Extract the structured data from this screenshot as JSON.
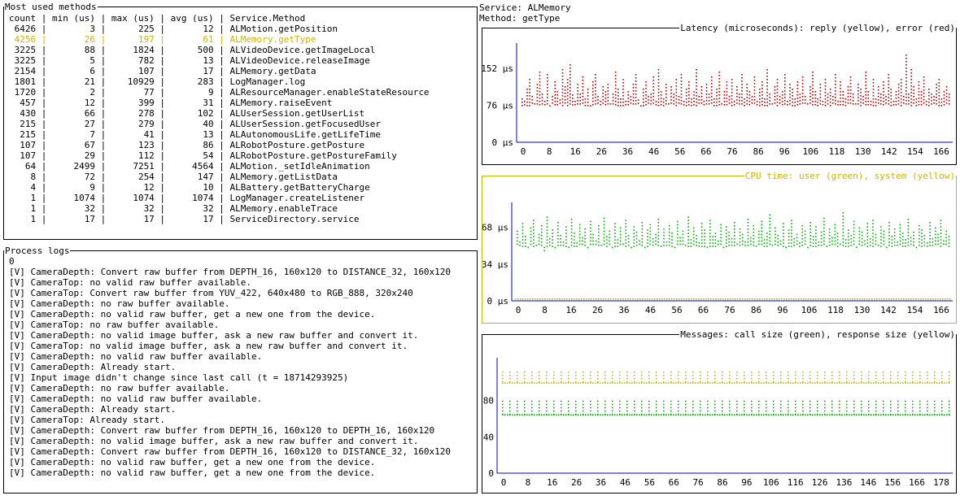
{
  "methods_panel": {
    "title": "Most used methods",
    "header": "count | min (us) | max (us) | avg (us) | Service.Method",
    "rows": [
      {
        "count": "6426",
        "min": "3",
        "max": "225",
        "avg": "12",
        "method": "ALMotion.getPosition",
        "highlight": false
      },
      {
        "count": "4256",
        "min": "26",
        "max": "197",
        "avg": "61",
        "method": "ALMemory.getType",
        "highlight": true
      },
      {
        "count": "3225",
        "min": "88",
        "max": "1824",
        "avg": "500",
        "method": "ALVideoDevice.getImageLocal",
        "highlight": false
      },
      {
        "count": "3225",
        "min": "5",
        "max": "782",
        "avg": "13",
        "method": "ALVideoDevice.releaseImage",
        "highlight": false
      },
      {
        "count": "2154",
        "min": "6",
        "max": "107",
        "avg": "17",
        "method": "ALMemory.getData",
        "highlight": false
      },
      {
        "count": "1801",
        "min": "21",
        "max": "10929",
        "avg": "283",
        "method": "LogManager.log",
        "highlight": false
      },
      {
        "count": "1720",
        "min": "2",
        "max": "77",
        "avg": "9",
        "method": "ALResourceManager.enableStateResource",
        "highlight": false
      },
      {
        "count": "457",
        "min": "12",
        "max": "399",
        "avg": "31",
        "method": "ALMemory.raiseEvent",
        "highlight": false
      },
      {
        "count": "430",
        "min": "66",
        "max": "278",
        "avg": "102",
        "method": "ALUserSession.getUserList",
        "highlight": false
      },
      {
        "count": "215",
        "min": "27",
        "max": "279",
        "avg": "40",
        "method": "ALUserSession.getFocusedUser",
        "highlight": false
      },
      {
        "count": "215",
        "min": "7",
        "max": "41",
        "avg": "13",
        "method": "ALAutonomousLife.getLifeTime",
        "highlight": false
      },
      {
        "count": "107",
        "min": "67",
        "max": "123",
        "avg": "86",
        "method": "ALRobotPosture.getPosture",
        "highlight": false
      },
      {
        "count": "107",
        "min": "29",
        "max": "112",
        "avg": "54",
        "method": "ALRobotPosture.getPostureFamily",
        "highlight": false
      },
      {
        "count": "64",
        "min": "2499",
        "max": "7251",
        "avg": "4564",
        "method": "ALMotion._setIdleAnimation",
        "highlight": false
      },
      {
        "count": "8",
        "min": "72",
        "max": "254",
        "avg": "147",
        "method": "ALMemory.getListData",
        "highlight": false
      },
      {
        "count": "4",
        "min": "9",
        "max": "12",
        "avg": "10",
        "method": "ALBattery.getBatteryCharge",
        "highlight": false
      },
      {
        "count": "1",
        "min": "1074",
        "max": "1074",
        "avg": "1074",
        "method": "LogManager.createListener",
        "highlight": false
      },
      {
        "count": "1",
        "min": "32",
        "max": "32",
        "avg": "32",
        "method": "ALMemory.enableTrace",
        "highlight": false
      },
      {
        "count": "1",
        "min": "17",
        "max": "17",
        "avg": "17",
        "method": "ServiceDirectory.service",
        "highlight": false
      }
    ]
  },
  "logs_panel": {
    "title": "Process logs",
    "lines": [
      "0",
      "[V] CameraDepth: Convert raw buffer from DEPTH_16, 160x120 to DISTANCE_32, 160x120",
      "[V] CameraTop: no valid raw buffer available.",
      "[V] CameraTop: Convert raw buffer from YUV_422, 640x480 to RGB_888, 320x240",
      "[V] CameraDepth: no raw buffer available.",
      "[V] CameraDepth: no valid raw buffer, get a new one from the device.",
      "[V] CameraTop: no raw buffer available.",
      "[V] CameraDepth: no valid image buffer, ask a new raw buffer and convert it.",
      "[V] CameraTop: no valid image buffer, ask a new raw buffer and convert it.",
      "[V] CameraDepth: no valid raw buffer available.",
      "[V] CameraDepth: Already start.",
      "[V] Input image didn't change since last call (t = 18714293925)",
      "[V] CameraDepth: no raw buffer available.",
      "[V] CameraDepth: no valid raw buffer available.",
      "[V] CameraDepth: Already start.",
      "[V] CameraTop: Already start.",
      "[V] CameraDepth: Convert raw buffer from DEPTH_16, 160x120 to DEPTH_16, 160x120",
      "[V] CameraDepth: no valid image buffer, ask a new raw buffer and convert it.",
      "[V] CameraDepth: Convert raw buffer from DEPTH_16, 160x120 to DISTANCE_32, 160x120",
      "[V] CameraDepth: no valid raw buffer, get a new one from the device.",
      "[V] CameraDepth: no valid raw buffer, get a new one from the device."
    ]
  },
  "info": {
    "service_label": "Service: ALMemory",
    "method_label": "Method: getType"
  },
  "colors": {
    "red": "#c00000",
    "green": "#00b000",
    "yellow": "#ccb400",
    "axis_blue": "#0000cc"
  },
  "chart_data": [
    {
      "type": "scatter",
      "title": "Latency (microseconds): reply (yellow), error (red)",
      "ytick_labels": [
        "152 µs",
        "76 µs",
        "0 µs"
      ],
      "yticks": [
        152,
        76,
        0
      ],
      "xtick_labels": [
        "0",
        "8",
        "16",
        "26",
        "36",
        "46",
        "56",
        "66",
        "76",
        "86",
        "96",
        "106",
        "118",
        "130",
        "142",
        "154",
        "166"
      ],
      "ylim": [
        0,
        190
      ],
      "xlim": [
        0,
        175
      ],
      "series": [
        {
          "color": "red",
          "style": "dotted-columns",
          "baseline": 76,
          "values": [
            90,
            85,
            110,
            130,
            95,
            80,
            120,
            145,
            100,
            85,
            140,
            75,
            95,
            125,
            105,
            88,
            150,
            115,
            130,
            160,
            98,
            85,
            120,
            100,
            135,
            90,
            110,
            70,
            125,
            140,
            95,
            85,
            115,
            105,
            120,
            80,
            100,
            145,
            110,
            90,
            130,
            85,
            105,
            95,
            120,
            140,
            88,
            75,
            110,
            125,
            95,
            100,
            135,
            85,
            150,
            105,
            90,
            120,
            80,
            115,
            100,
            130,
            95,
            140,
            85,
            110,
            125,
            90,
            105,
            150,
            95,
            115,
            85,
            120,
            100,
            135,
            90,
            110,
            145,
            80,
            105,
            125,
            95,
            130,
            85,
            115,
            100,
            140,
            90,
            120,
            105,
            95,
            135,
            85,
            110,
            125,
            90,
            150,
            100,
            80,
            115,
            130,
            95,
            105,
            140,
            85,
            120,
            110,
            90,
            125,
            100,
            135,
            95,
            80,
            115,
            145,
            105,
            90,
            120,
            85,
            130,
            100,
            110,
            95,
            140,
            85,
            125,
            105,
            90,
            115,
            135,
            100,
            80,
            120,
            110,
            95,
            145,
            105,
            85,
            130,
            90,
            115,
            100,
            125,
            95,
            140,
            110,
            85,
            105,
            120,
            130,
            95,
            180,
            100,
            150,
            115,
            90,
            125,
            105,
            135,
            85,
            110,
            100,
            95,
            120,
            130,
            90,
            105,
            115,
            100
          ]
        }
      ]
    },
    {
      "type": "scatter",
      "title": "CPU time: user (green), system (yellow)",
      "ytick_labels": [
        "68 µs",
        "34 µs",
        "0 µs"
      ],
      "yticks": [
        68,
        34,
        0
      ],
      "xtick_labels": [
        "0",
        "8",
        "16",
        "26",
        "36",
        "46",
        "56",
        "66",
        "76",
        "86",
        "96",
        "106",
        "118",
        "130",
        "142",
        "154",
        "166"
      ],
      "ylim": [
        0,
        85
      ],
      "xlim": [
        0,
        175
      ],
      "series": [
        {
          "color": "green",
          "style": "dotted-columns",
          "baseline": 50,
          "values": [
            65,
            55,
            72,
            60,
            48,
            68,
            75,
            52,
            62,
            70,
            45,
            78,
            58,
            66,
            50,
            73,
            61,
            55,
            69,
            47,
            76,
            63,
            54,
            71,
            59,
            67,
            49,
            74,
            62,
            56,
            70,
            52,
            77,
            60,
            65,
            48,
            72,
            57,
            68,
            53,
            75,
            61,
            50,
            69,
            64,
            56,
            73,
            47,
            66,
            71,
            58,
            62,
            76,
            51,
            67,
            55,
            70,
            63,
            49,
            74,
            59,
            65,
            52,
            78,
            57,
            68,
            61,
            54,
            72,
            66,
            50,
            75,
            60,
            63,
            56,
            71,
            48,
            69,
            64,
            58,
            73,
            53,
            67,
            62,
            55,
            76,
            59,
            70,
            51,
            65,
            74,
            57,
            63,
            80,
            52,
            68,
            61,
            56,
            72,
            49,
            66,
            75,
            58,
            62,
            54,
            70,
            65,
            47,
            73,
            60,
            69,
            55,
            64,
            77,
            51,
            67,
            59,
            71,
            63,
            53,
            82,
            57,
            66,
            61,
            74,
            50,
            68,
            64,
            56,
            72,
            58,
            75,
            62,
            52,
            69,
            65,
            48,
            73,
            60,
            67,
            55,
            71,
            63,
            57,
            76,
            59,
            64,
            50,
            70,
            66,
            61,
            54,
            73,
            58,
            68,
            62,
            75,
            56,
            65,
            60
          ]
        },
        {
          "color": "yellow",
          "style": "flat",
          "values_const": 0
        }
      ]
    },
    {
      "type": "scatter",
      "title": "Messages: call size (green), response size (yellow)",
      "ytick_labels": [
        "80",
        "40",
        "0"
      ],
      "yticks": [
        80,
        40,
        0
      ],
      "xtick_labels": [
        "0",
        "8",
        "16",
        "26",
        "36",
        "46",
        "56",
        "66",
        "76",
        "86",
        "96",
        "106",
        "116",
        "126",
        "136",
        "146",
        "156",
        "166",
        "178"
      ],
      "ylim": [
        0,
        120
      ],
      "xlim": [
        0,
        185
      ],
      "series": [
        {
          "color": "yellow",
          "style": "spikes",
          "base": 100,
          "peak": 112,
          "period": 3
        },
        {
          "color": "green",
          "style": "spikes",
          "base": 65,
          "peak": 80,
          "period": 3
        }
      ]
    }
  ]
}
